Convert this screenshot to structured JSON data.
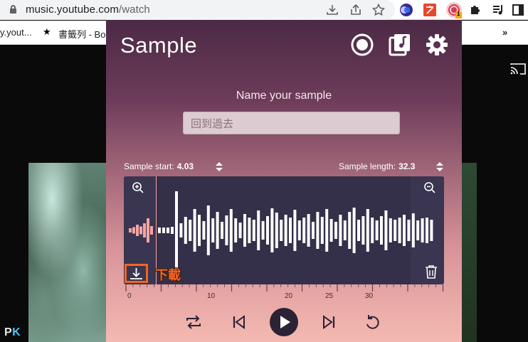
{
  "browser": {
    "url_host": "music.youtube.com",
    "url_path": "/watch",
    "bookmark_tab": "y.yout...",
    "bookmark_folder": "書籤列 - Boo",
    "bookmarks_more": "»",
    "extension_badge": "1"
  },
  "popup": {
    "title": "Sample",
    "name_label": "Name your sample",
    "name_value": "回到過去",
    "sample_start_label": "Sample start:",
    "sample_start_value": "4.03",
    "sample_length_label": "Sample length:",
    "sample_length_value": "32.3",
    "ruler_ticks": [
      "0",
      "10",
      "20",
      "25",
      "30"
    ],
    "download_annotation": "下載",
    "colors": {
      "accent": "#f26522",
      "wave_panel": "#343049",
      "selected_wave": "#f4a6a6"
    }
  },
  "watermark": {
    "pk_p": "P",
    "pk_k": "K"
  }
}
